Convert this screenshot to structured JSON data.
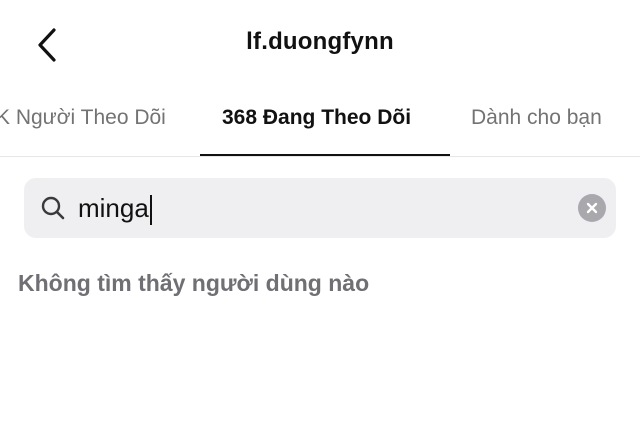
{
  "header": {
    "title": "lf.duongfynn",
    "back_icon": "chevron-left-icon"
  },
  "tabs": [
    {
      "label": "K Người Theo Dõi",
      "active": false
    },
    {
      "label": "368 Đang Theo Dõi",
      "active": true
    },
    {
      "label": "Dành cho bạn",
      "active": false
    }
  ],
  "search": {
    "value": "minga",
    "icon": "search-icon",
    "clear_icon": "clear-icon"
  },
  "results": {
    "empty_message": "Không tìm thấy người dùng nào"
  },
  "colors": {
    "text_primary": "#111111",
    "text_secondary": "#737373",
    "search_bg": "#efeff2",
    "clear_bg": "#a8a8ad"
  }
}
